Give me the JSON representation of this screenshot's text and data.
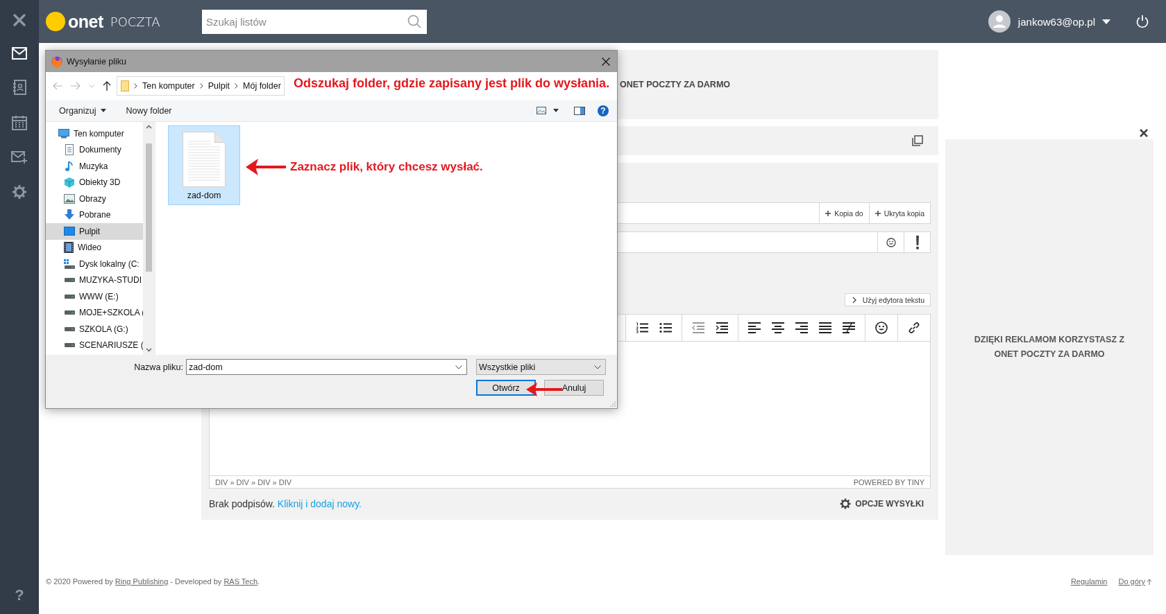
{
  "sidebar": {
    "items": [
      {
        "kind": "mail",
        "selected": true
      },
      {
        "kind": "contacts",
        "selected": false
      },
      {
        "kind": "calendar",
        "selected": false
      },
      {
        "kind": "compose",
        "selected": false
      },
      {
        "kind": "settings",
        "selected": false
      }
    ],
    "help": "?"
  },
  "header": {
    "logo": "onet",
    "product": "POCZTA",
    "search": {
      "placeholder": "Szukaj listów"
    },
    "user": "jankow63@op.pl"
  },
  "banner": {
    "text": "ONET POCZTY ZA DARMO"
  },
  "compose": {
    "copy_buttons": [
      "Kopia do",
      "Ukryta kopia"
    ],
    "editor_switch": "Użyj edytora tekstu",
    "toolbar": [
      [
        {
          "kind": "ol",
          "disabled": false
        },
        {
          "kind": "ul",
          "disabled": false
        }
      ],
      [
        {
          "kind": "outdent",
          "disabled": true
        },
        {
          "kind": "indent",
          "disabled": false
        }
      ],
      [
        {
          "kind": "align-left",
          "disabled": false
        },
        {
          "kind": "align-center",
          "disabled": false
        },
        {
          "kind": "align-right",
          "disabled": false
        },
        {
          "kind": "justify",
          "disabled": false
        },
        {
          "kind": "clear-format",
          "disabled": false
        }
      ],
      [
        {
          "kind": "emoji",
          "disabled": false
        }
      ],
      [
        {
          "kind": "link",
          "disabled": false
        }
      ]
    ],
    "path": "DIV » DIV » DIV » DIV",
    "powered_by": "POWERED BY TINY",
    "signature": {
      "text": "Brak podpisów.",
      "link": "Kliknij i dodaj nowy."
    },
    "send_options": "OPCJE WYSYŁKI"
  },
  "side_ad": {
    "text": "DZIĘKI REKLAMOM KORZYSTASZ Z ONET POCZTY ZA DARMO"
  },
  "footer": {
    "parts": [
      {
        "text": "© 2020 Powered by ",
        "link": false
      },
      {
        "text": "Ring Publishing",
        "link": true
      },
      {
        "text": " - Developed by ",
        "link": false
      },
      {
        "text": "RAS Tech",
        "link": true
      },
      {
        "text": ".",
        "link": false
      }
    ],
    "links": [
      "Regulamin",
      "Do góry"
    ]
  },
  "dialog": {
    "title": "Wysyłanie pliku",
    "path": [
      "Ten komputer",
      "Pulpit",
      "Mój folder"
    ],
    "commands": [
      {
        "label": "Organizuj",
        "menu": true
      },
      {
        "label": "Nowy folder",
        "menu": false
      }
    ],
    "help": "?",
    "nav": [
      {
        "label": "Ten komputer",
        "kind": "computer",
        "selected": false,
        "children": [
          {
            "label": "Dokumenty",
            "kind": "documents",
            "selected": false
          },
          {
            "label": "Muzyka",
            "kind": "music",
            "selected": false
          },
          {
            "label": "Obiekty 3D",
            "kind": "objects3d",
            "selected": false
          },
          {
            "label": "Obrazy",
            "kind": "pictures",
            "selected": false
          },
          {
            "label": "Pobrane",
            "kind": "downloads",
            "selected": false
          },
          {
            "label": "Pulpit",
            "kind": "desktop",
            "selected": true
          },
          {
            "label": "Wideo",
            "kind": "video",
            "selected": false
          },
          {
            "label": "Dysk lokalny (C:",
            "kind": "system-drive",
            "selected": false
          },
          {
            "label": "MUZYKA-STUDI",
            "kind": "drive",
            "selected": false
          },
          {
            "label": "WWW (E:)",
            "kind": "drive",
            "selected": false
          },
          {
            "label": "MOJE+SZKOLA (",
            "kind": "drive",
            "selected": false
          },
          {
            "label": "SZKOLA (G:)",
            "kind": "drive",
            "selected": false
          },
          {
            "label": "SCENARIUSZE (",
            "kind": "drive",
            "selected": false
          }
        ]
      }
    ],
    "files": [
      {
        "name": "zad-dom",
        "selected": true
      }
    ],
    "filename_label": "Nazwa pliku:",
    "filename": "zad-dom",
    "filter": "Wszystkie pliki",
    "buttons": [
      {
        "label": "Otwórz",
        "kind": "default"
      },
      {
        "label": "Anuluj",
        "kind": "normal"
      }
    ]
  },
  "annotations": [
    {
      "kind": "note",
      "text": "Odszukaj folder, gdzie zapisany jest plik do wysłania."
    },
    {
      "kind": "arrow-note",
      "text": "Zaznacz plik, który chcesz wysłać."
    },
    {
      "kind": "arrow"
    }
  ]
}
